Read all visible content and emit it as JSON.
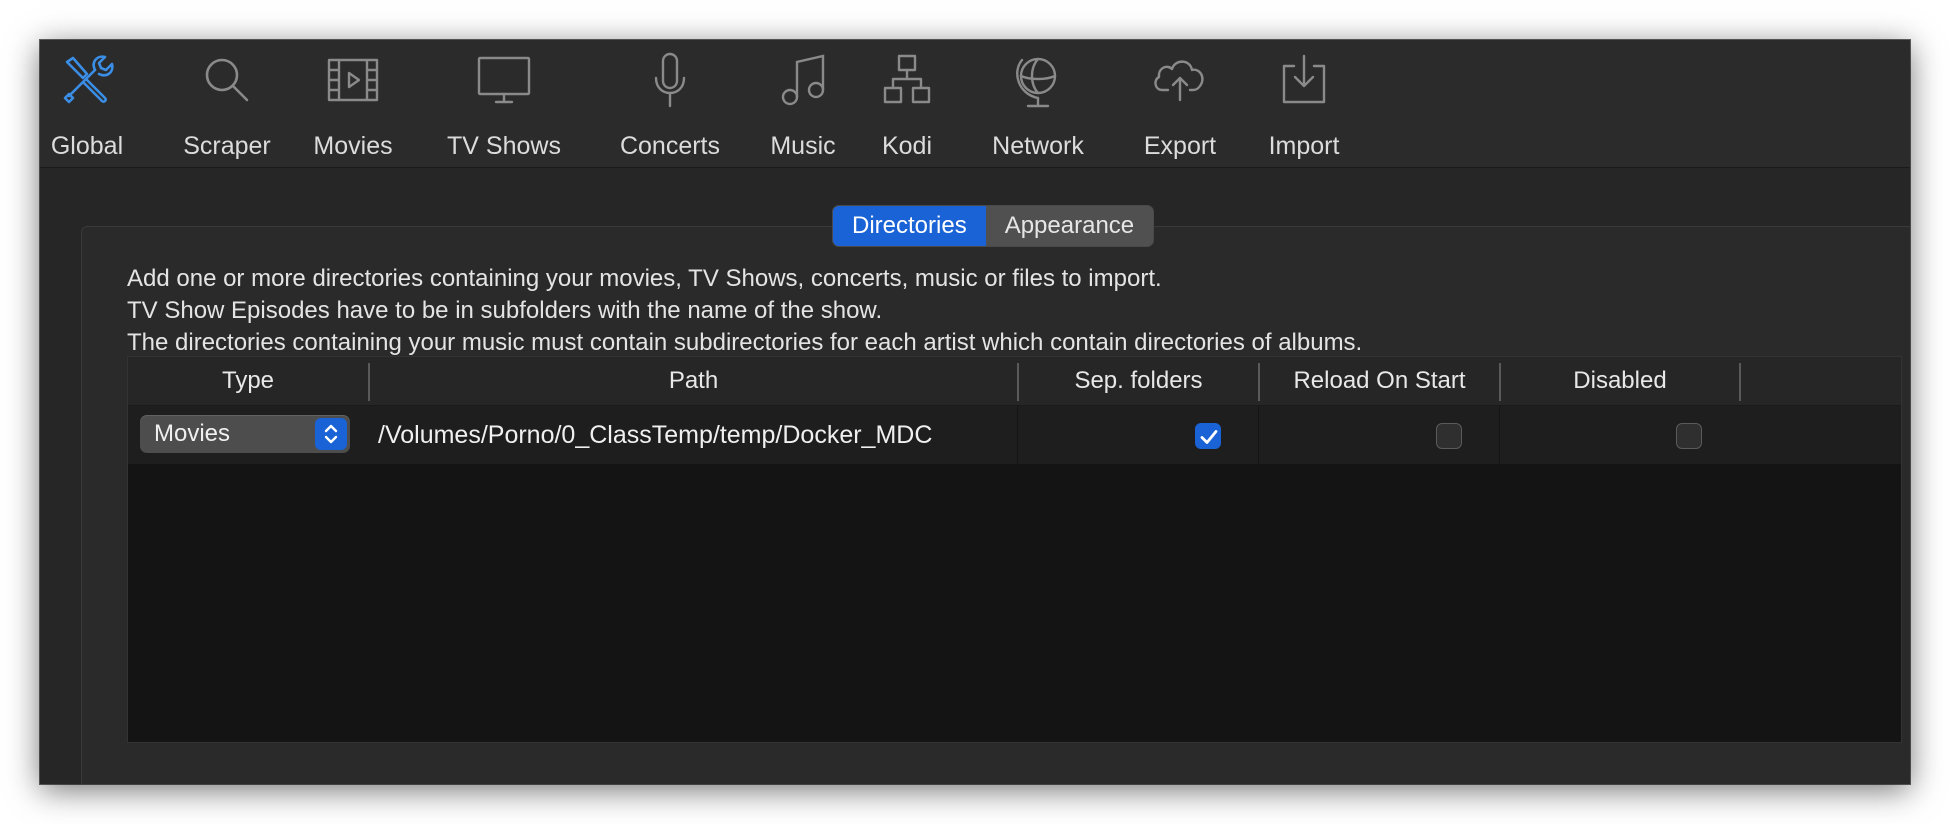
{
  "toolbar": {
    "items": [
      {
        "label": "Global",
        "icon": "tools-icon",
        "active": true
      },
      {
        "label": "Scraper",
        "icon": "search-icon"
      },
      {
        "label": "Movies",
        "icon": "film-icon"
      },
      {
        "label": "TV Shows",
        "icon": "monitor-icon"
      },
      {
        "label": "Concerts",
        "icon": "microphone-icon"
      },
      {
        "label": "Music",
        "icon": "music-note-icon"
      },
      {
        "label": "Kodi",
        "icon": "network-tree-icon"
      },
      {
        "label": "Network",
        "icon": "globe-icon"
      },
      {
        "label": "Export",
        "icon": "cloud-upload-icon"
      },
      {
        "label": "Import",
        "icon": "tray-download-icon"
      }
    ]
  },
  "tabs": {
    "directories": "Directories",
    "appearance": "Appearance",
    "active": "Directories"
  },
  "description": {
    "line1": "Add one or more directories containing your movies, TV Shows, concerts, music or files to import.",
    "line2": "TV Show Episodes have to be in subfolders with the name of the show.",
    "line3": "The directories containing your music must contain subdirectories for each artist which contain directories of albums."
  },
  "table": {
    "headers": {
      "type": "Type",
      "path": "Path",
      "sep_folders": "Sep. folders",
      "reload_on_start": "Reload On Start",
      "disabled": "Disabled"
    },
    "rows": [
      {
        "type": "Movies",
        "path": "/Volumes/Porno/0_ClassTemp/temp/Docker_MDC",
        "sep_folders": true,
        "reload_on_start": false,
        "disabled": false
      }
    ]
  },
  "colors": {
    "accent": "#1a63d6",
    "active_icon": "#3a8ee6",
    "icon": "#8a8a8a",
    "window_bg": "#262626",
    "table_bg": "#141414"
  }
}
